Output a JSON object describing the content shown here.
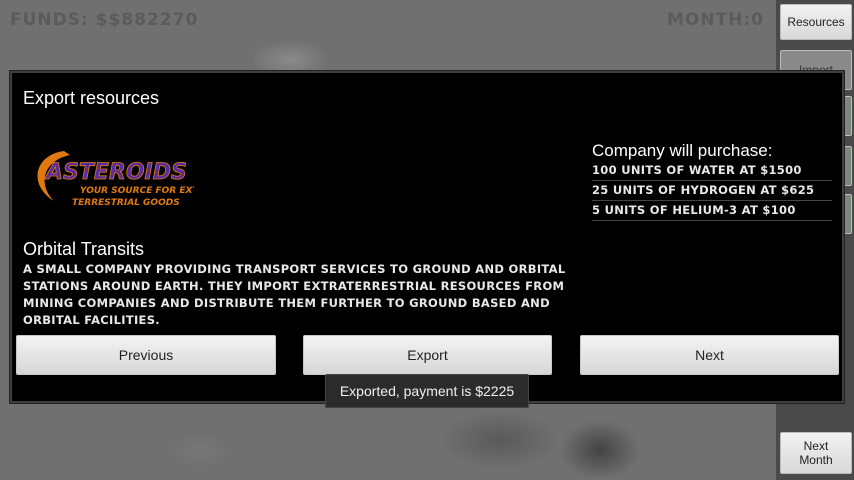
{
  "hud": {
    "funds": "FUNDS: $$882270",
    "month": "MONTH:0"
  },
  "side_panel": {
    "resources_label": "Resources",
    "import_label": "Import",
    "next_month_label": "Next\nMonth"
  },
  "dialog": {
    "title": "Export resources",
    "logo": {
      "name": "ASTEROIDS INC",
      "tagline_1": "YOUR SOURCE FOR EXTRA-",
      "tagline_2": "TERRESTRIAL GOODS"
    },
    "company_name": "Orbital Transits",
    "company_description": "A small company providing transport services to ground and orbital stations around Earth. They import extraterrestrial resources from mining companies and distribute them further to ground based and orbital facilities.",
    "purchase_heading": "Company will purchase:",
    "purchases": [
      "100 units of Water at $1500",
      "25 units of Hydrogen at $625",
      "5 units of Helium-3 at $100"
    ],
    "buttons": {
      "previous": "Previous",
      "export": "Export",
      "next": "Next"
    }
  },
  "toast": "Exported, payment is $2225",
  "colors": {
    "dialog_bg": "#000000",
    "logo_purple": "#5a2aa0",
    "logo_orange": "#e07a10"
  }
}
